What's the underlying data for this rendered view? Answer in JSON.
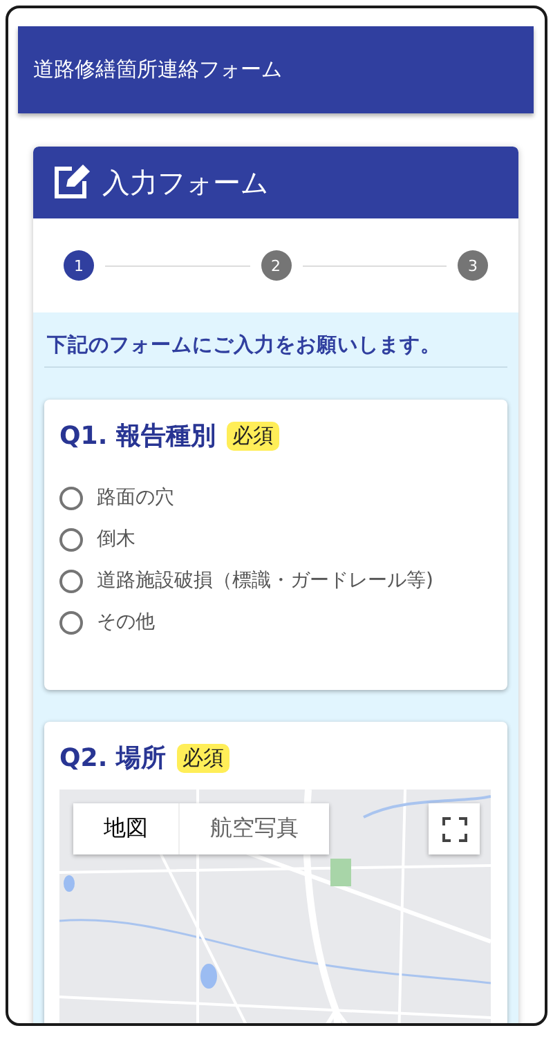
{
  "header": {
    "title": "道路修繕箇所連絡フォーム"
  },
  "form": {
    "title": "入力フォーム",
    "steps": [
      {
        "label": "1",
        "selected": true
      },
      {
        "label": "2",
        "selected": false
      },
      {
        "label": "3",
        "selected": false
      }
    ],
    "intro": "下記のフォームにご入力をお願いします。",
    "questions": [
      {
        "kind": "radio",
        "title": "Q1. 報告種別",
        "badge": "必須",
        "options": [
          {
            "label": "路面の穴",
            "checked": false
          },
          {
            "label": "倒木",
            "checked": false
          },
          {
            "label": "道路施設破損（標識・ガードレール等)",
            "checked": false
          },
          {
            "label": "その他",
            "checked": false
          }
        ]
      },
      {
        "kind": "map",
        "title": "Q2. 場所",
        "badge": "必須",
        "map_types": [
          {
            "label": "地図",
            "selected": true
          },
          {
            "label": "航空写真",
            "selected": false
          }
        ]
      }
    ]
  }
}
